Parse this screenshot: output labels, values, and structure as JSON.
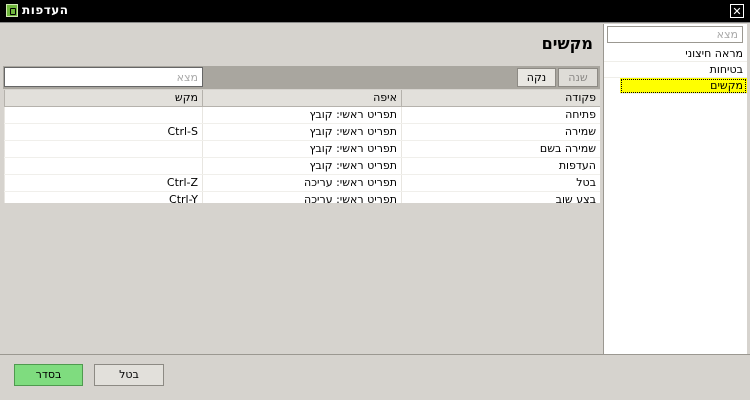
{
  "window": {
    "title": "העדפות",
    "close_glyph": "✕"
  },
  "sidebar": {
    "search_placeholder": "מצא",
    "items": [
      {
        "label": "מראה חיצוני",
        "selected": false
      },
      {
        "label": "בטיחות",
        "selected": false
      },
      {
        "label": "מקשים",
        "selected": true
      }
    ]
  },
  "main": {
    "title": "מקשים",
    "toolbar": {
      "change_label": "שנה",
      "clear_label": "נקה",
      "search_placeholder": "מצא"
    },
    "table": {
      "columns": [
        "פקודה",
        "איפה",
        "מקש"
      ],
      "rows": [
        {
          "command": "פתיחה",
          "where": "תפריט ראשי: קובץ",
          "key": ""
        },
        {
          "command": "שמירה",
          "where": "תפריט ראשי: קובץ",
          "key": "Ctrl-S"
        },
        {
          "command": "שמירה בשם",
          "where": "תפריט ראשי: קובץ",
          "key": ""
        },
        {
          "command": "העדפות",
          "where": "תפריט ראשי: קובץ",
          "key": ""
        },
        {
          "command": "בטל",
          "where": "תפריט ראשי: עריכה",
          "key": "Ctrl-Z"
        },
        {
          "command": "בצע שוב",
          "where": "תפריט ראשי: עריכה",
          "key": "Ctrl-Y"
        }
      ]
    }
  },
  "footer": {
    "ok_label": "בסדר",
    "cancel_label": "בטל"
  },
  "colors": {
    "ok_button": "#7fdc7f",
    "selected_item": "#ffff00",
    "titlebar": "#000000"
  }
}
